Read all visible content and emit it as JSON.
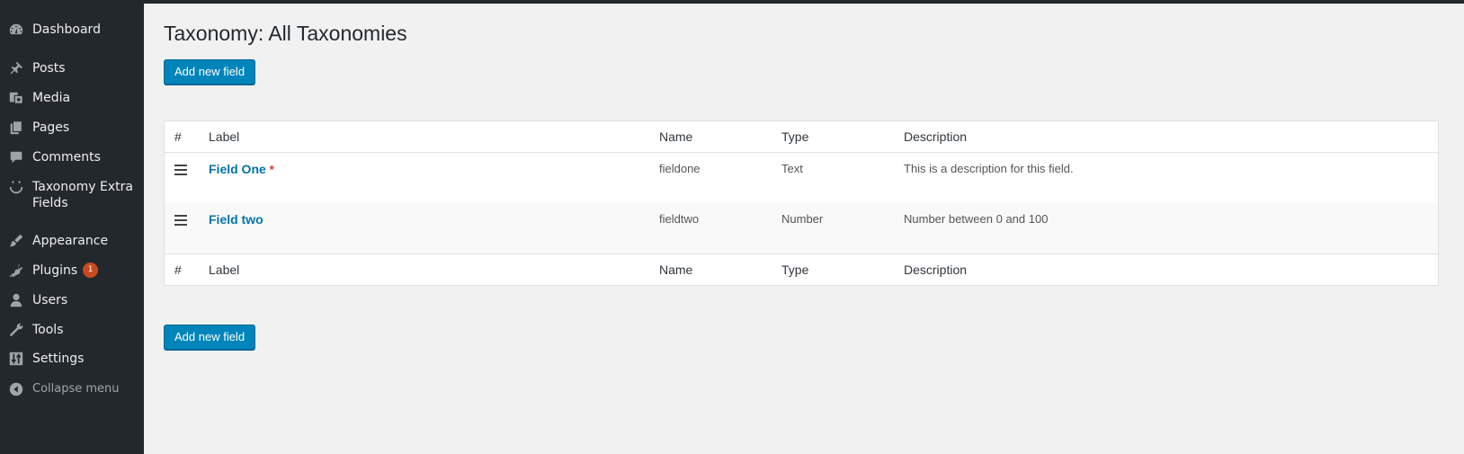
{
  "sidebar": {
    "items": [
      {
        "label": "Dashboard",
        "icon": "dashboard-icon"
      },
      {
        "label": "Posts",
        "icon": "pin-icon"
      },
      {
        "label": "Media",
        "icon": "media-icon"
      },
      {
        "label": "Pages",
        "icon": "pages-icon"
      },
      {
        "label": "Comments",
        "icon": "comment-icon"
      },
      {
        "label": "Taxonomy Extra Fields",
        "icon": "smiley-icon"
      },
      {
        "label": "Appearance",
        "icon": "brush-icon"
      },
      {
        "label": "Plugins",
        "icon": "plugin-icon",
        "badge": "1"
      },
      {
        "label": "Users",
        "icon": "user-icon"
      },
      {
        "label": "Tools",
        "icon": "wrench-icon"
      },
      {
        "label": "Settings",
        "icon": "settings-icon"
      }
    ],
    "collapse_label": "Collapse menu"
  },
  "page": {
    "title": "Taxonomy: All Taxonomies",
    "add_button_label": "Add new field"
  },
  "table": {
    "columns": [
      "#",
      "Label",
      "Name",
      "Type",
      "Description"
    ],
    "rows": [
      {
        "label": "Field One",
        "required_mark": "*",
        "name": "fieldone",
        "type": "Text",
        "description": "This is a description for this field."
      },
      {
        "label": "Field two",
        "required_mark": "",
        "name": "fieldtwo",
        "type": "Number",
        "description": "Number between 0 and 100"
      }
    ]
  },
  "colors": {
    "sidebar_bg": "#23282d",
    "accent": "#0085ba",
    "link": "#0073aa",
    "badge": "#ca4a1f",
    "required": "#dc3232"
  }
}
